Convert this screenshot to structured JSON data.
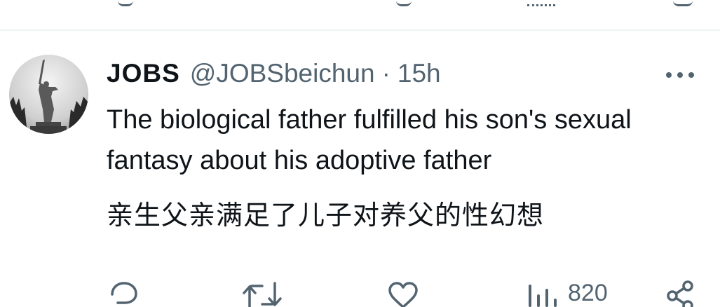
{
  "tweet": {
    "display_name": "JOBS",
    "handle": "@JOBSbeichun",
    "separator": "·",
    "time": "15h",
    "text_en": "The biological father fulfilled his son's sexual fantasy about his adoptive father",
    "text_zh": "亲生父亲满足了儿子对养父的性幻想"
  },
  "actions": {
    "reply_icon": "reply-icon",
    "retweet_icon": "retweet-icon",
    "like_icon": "heart-icon",
    "views_icon": "views-icon",
    "views_count": "820",
    "share_icon": "share-icon"
  },
  "colors": {
    "text": "#0f1419",
    "secondary": "#536471",
    "divider": "#eff3f4"
  }
}
